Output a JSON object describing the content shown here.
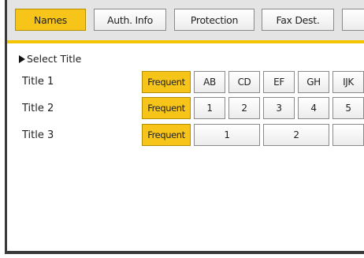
{
  "tabs": [
    {
      "label": "Names",
      "active": true
    },
    {
      "label": "Auth. Info",
      "active": false
    },
    {
      "label": "Protection",
      "active": false
    },
    {
      "label": "Fax Dest.",
      "active": false
    },
    {
      "label": "",
      "active": false
    }
  ],
  "section": {
    "title": "Select Title"
  },
  "rows": [
    {
      "label": "Title 1",
      "frequent": "Frequent",
      "keys": [
        "AB",
        "CD",
        "EF",
        "GH",
        "IJK"
      ]
    },
    {
      "label": "Title 2",
      "frequent": "Frequent",
      "keys": [
        "1",
        "2",
        "3",
        "4",
        "5"
      ]
    },
    {
      "label": "Title 3",
      "frequent": "Frequent",
      "keys": [
        "1",
        "2",
        ""
      ]
    }
  ],
  "colors": {
    "active_tab": "#f7c51a",
    "tab_strip": "#f5c400",
    "frame": "#3a3a3a"
  }
}
